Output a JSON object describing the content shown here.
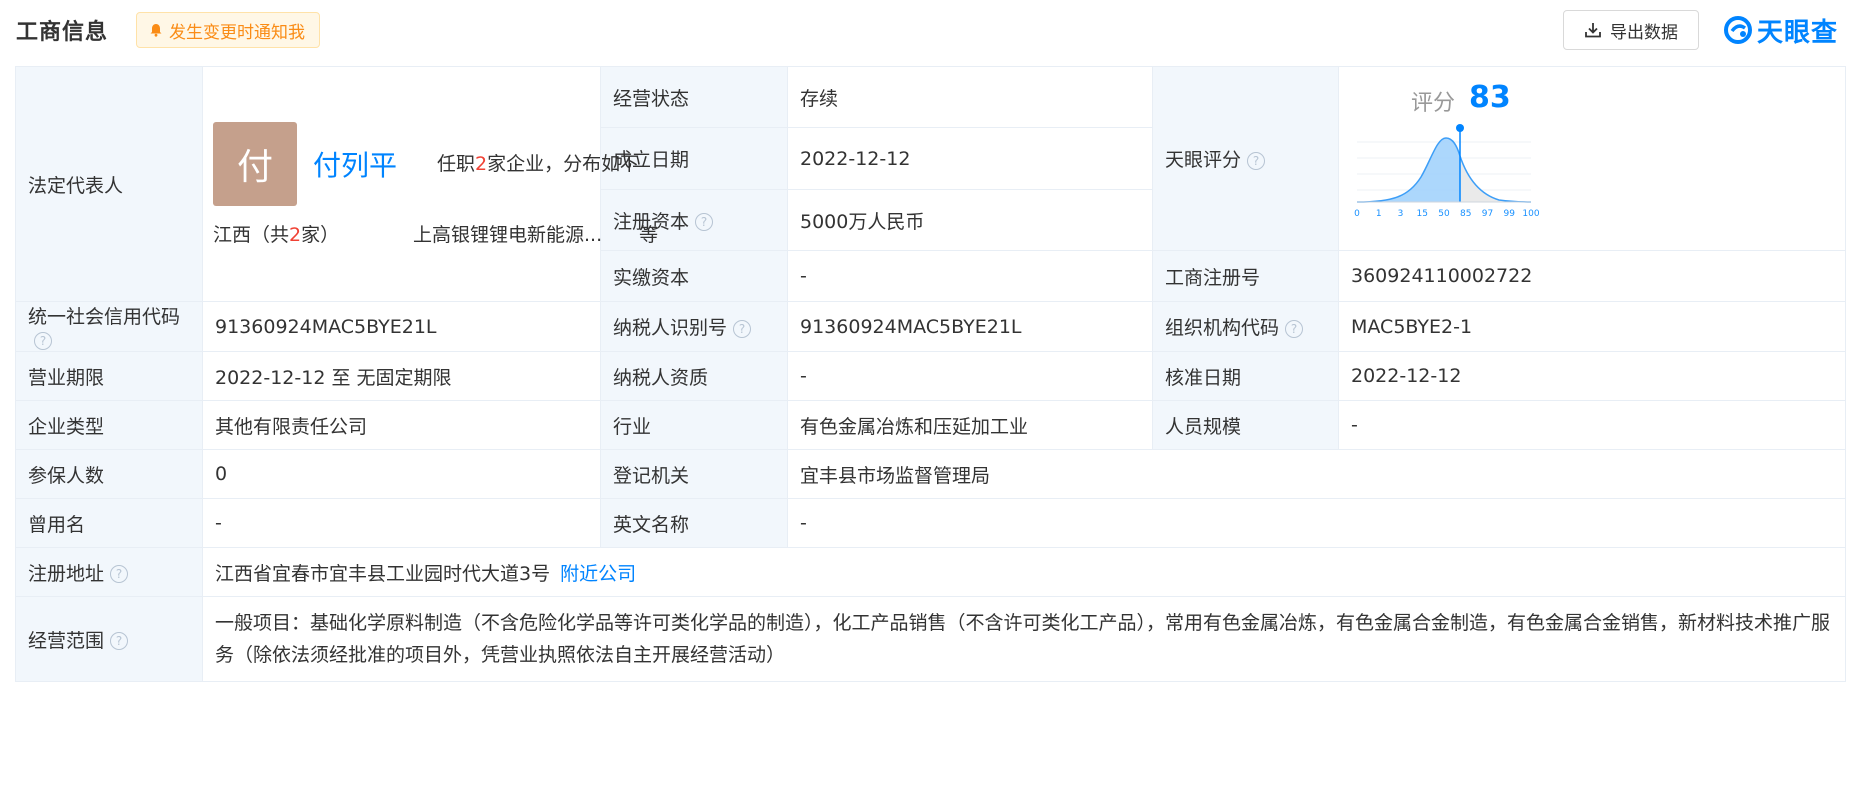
{
  "header": {
    "title": "工商信息",
    "notify_label": "发生变更时通知我",
    "export_label": "导出数据",
    "brand": "天眼查"
  },
  "legal_rep": {
    "label": "法定代表人",
    "avatar_char": "付",
    "name": "付列平",
    "posts_prefix": "任职",
    "posts_count": "2",
    "posts_suffix": "家企业，分布如下",
    "region_prefix": "江西（共",
    "region_count": "2",
    "region_suffix": "家）",
    "company": "上高银锂锂电新能源...",
    "etc": "等"
  },
  "rows": {
    "status_label": "经营状态",
    "status": "存续",
    "founded_label": "成立日期",
    "founded": "2022-12-12",
    "reg_capital_label": "注册资本",
    "reg_capital": "5000万人民币",
    "paid_capital_label": "实缴资本",
    "paid_capital": "-",
    "score_label": "天眼评分",
    "reg_no_label": "工商注册号",
    "reg_no": "360924110002722",
    "credit_code_label": "统一社会信用代码",
    "credit_code": "91360924MAC5BYE21L",
    "taxpayer_id_label": "纳税人识别号",
    "taxpayer_id": "91360924MAC5BYE21L",
    "org_code_label": "组织机构代码",
    "org_code": "MAC5BYE2-1",
    "term_label": "营业期限",
    "term": "2022-12-12 至 无固定期限",
    "taxpayer_qual_label": "纳税人资质",
    "taxpayer_qual": "-",
    "approve_date_label": "核准日期",
    "approve_date": "2022-12-12",
    "type_label": "企业类型",
    "type": "其他有限责任公司",
    "industry_label": "行业",
    "industry": "有色金属冶炼和压延加工业",
    "staff_label": "人员规模",
    "staff": "-",
    "insured_label": "参保人数",
    "insured": "0",
    "authority_label": "登记机关",
    "authority": "宜丰县市场监督管理局",
    "former_name_label": "曾用名",
    "former_name": "-",
    "english_name_label": "英文名称",
    "english_name": "-",
    "address_label": "注册地址",
    "address": "江西省宜春市宜丰县工业园时代大道3号",
    "nearby_label": "附近公司",
    "scope_label": "经营范围",
    "scope": "一般项目：基础化学原料制造（不含危险化学品等许可类化学品的制造），化工产品销售（不含许可类化工产品），常用有色金属冶炼，有色金属合金制造，有色金属合金销售，新材料技术推广服务（除依法须经批准的项目外，凭营业执照依法自主开展经营活动）"
  },
  "score": {
    "label": "评分",
    "value": "83",
    "axis_ticks": [
      "0",
      "1",
      "3",
      "15",
      "50",
      "85",
      "97",
      "99",
      "100"
    ],
    "accent": "#0084ff"
  },
  "help_glyph": "?"
}
